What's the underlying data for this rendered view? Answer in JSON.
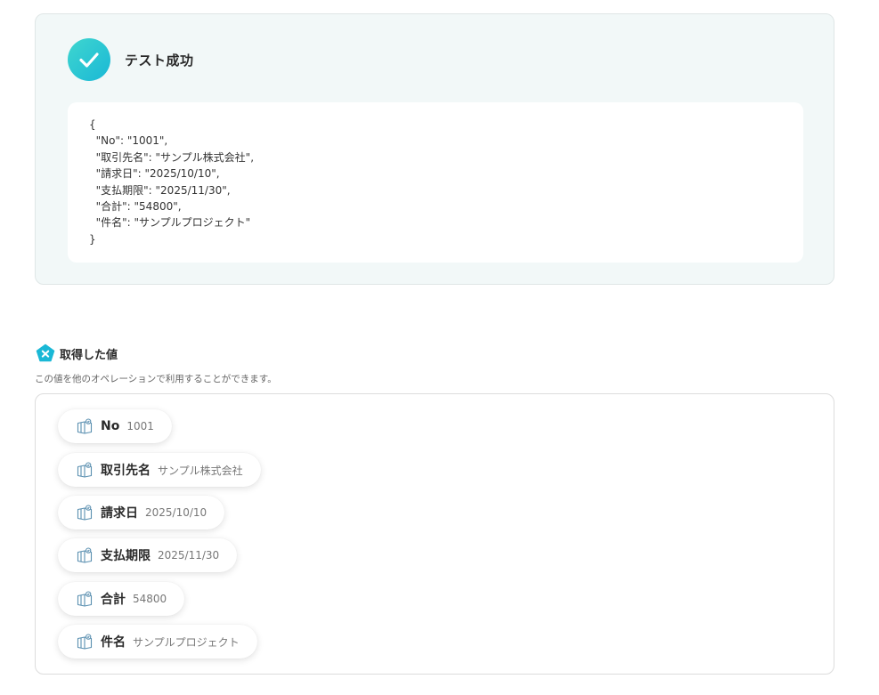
{
  "result": {
    "title": "テスト成功",
    "json_lines": [
      "{",
      "  \"No\": \"1001\",",
      "  \"取引先名\": \"サンプル株式会社\",",
      "  \"請求日\": \"2025/10/10\",",
      "  \"支払期限\": \"2025/11/30\",",
      "  \"合計\": \"54800\",",
      "  \"件名\": \"サンプルプロジェクト\"",
      "}"
    ]
  },
  "values_section": {
    "title": "取得した値",
    "description": "この値を他のオペレーションで利用することができます。",
    "items": [
      {
        "key": "No",
        "value": "1001"
      },
      {
        "key": "取引先名",
        "value": "サンプル株式会社"
      },
      {
        "key": "請求日",
        "value": "2025/10/10"
      },
      {
        "key": "支払期限",
        "value": "2025/11/30"
      },
      {
        "key": "合計",
        "value": "54800"
      },
      {
        "key": "件名",
        "value": "サンプルプロジェクト"
      }
    ]
  },
  "colors": {
    "accent": "#1ab8d6",
    "accent_light": "#3fd6cf",
    "card_bg": "#f2f8f8",
    "icon_blue": "#5a8fb0"
  },
  "icons": {
    "success": "check-circle-icon",
    "section": "yoom-pentagon-icon",
    "chip": "value-box-icon"
  }
}
